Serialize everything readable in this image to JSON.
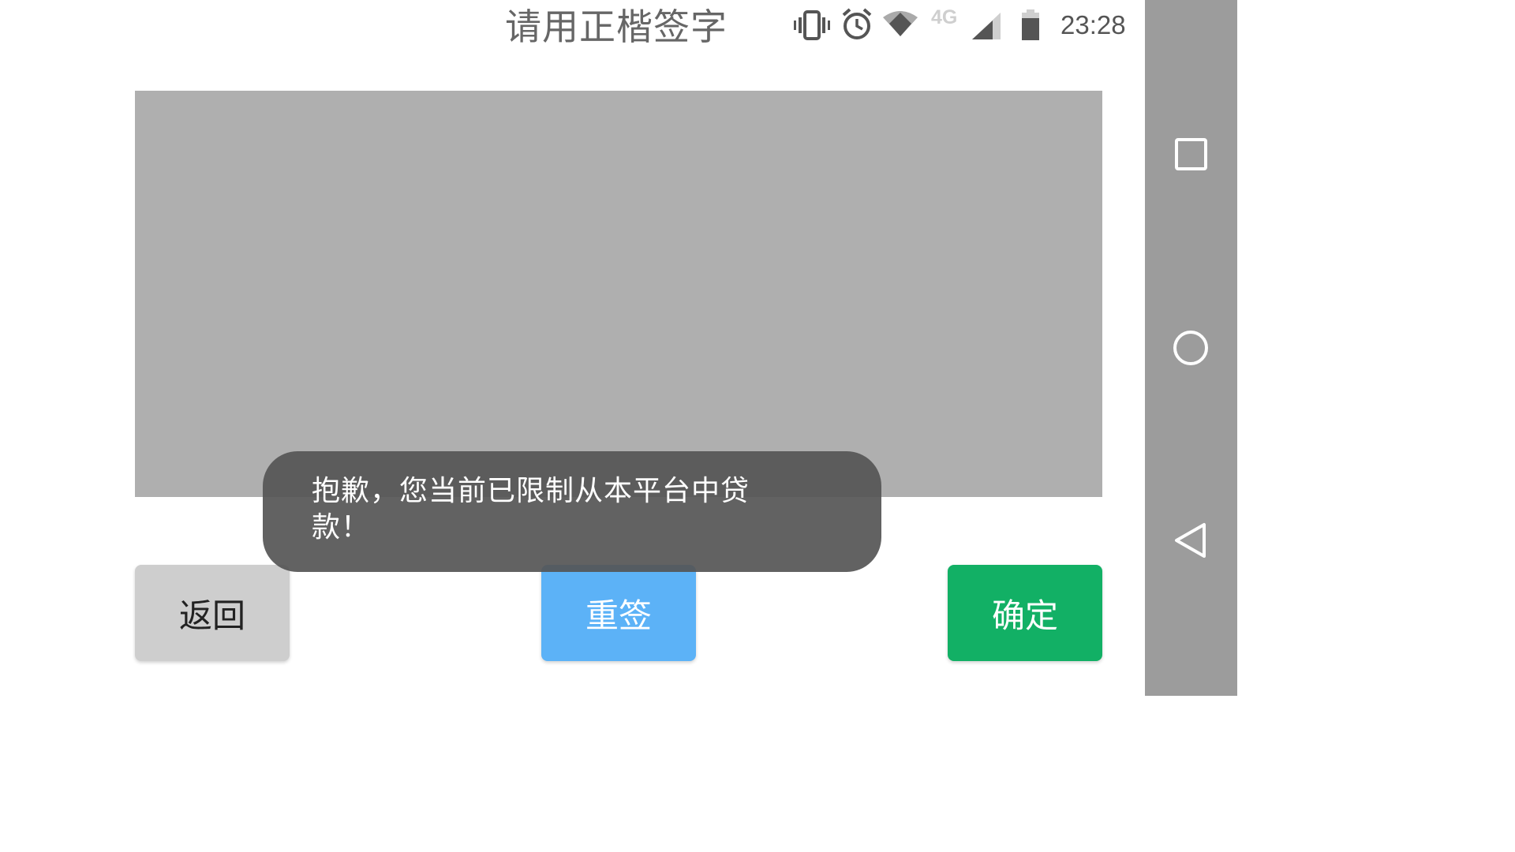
{
  "header": {
    "title": "请用正楷签字"
  },
  "status_bar": {
    "time": "23:28",
    "network_type": "4G",
    "icons": [
      "vibrate-icon",
      "alarm-icon",
      "wifi-icon",
      "signal-icon",
      "battery-icon"
    ]
  },
  "signature_pad": {
    "color": "#afafaf"
  },
  "buttons": {
    "back_label": "返回",
    "resign_label": "重签",
    "confirm_label": "确定"
  },
  "toast": {
    "message": "抱歉，您当前已限制从本平台中贷款！"
  },
  "nav_bar": {
    "icons": [
      "recents-icon",
      "home-icon",
      "back-icon"
    ]
  },
  "colors": {
    "back_button": "#cecece",
    "resign_button": "#5cb2f7",
    "confirm_button": "#12b065",
    "nav_bar": "#9c9c9c"
  }
}
